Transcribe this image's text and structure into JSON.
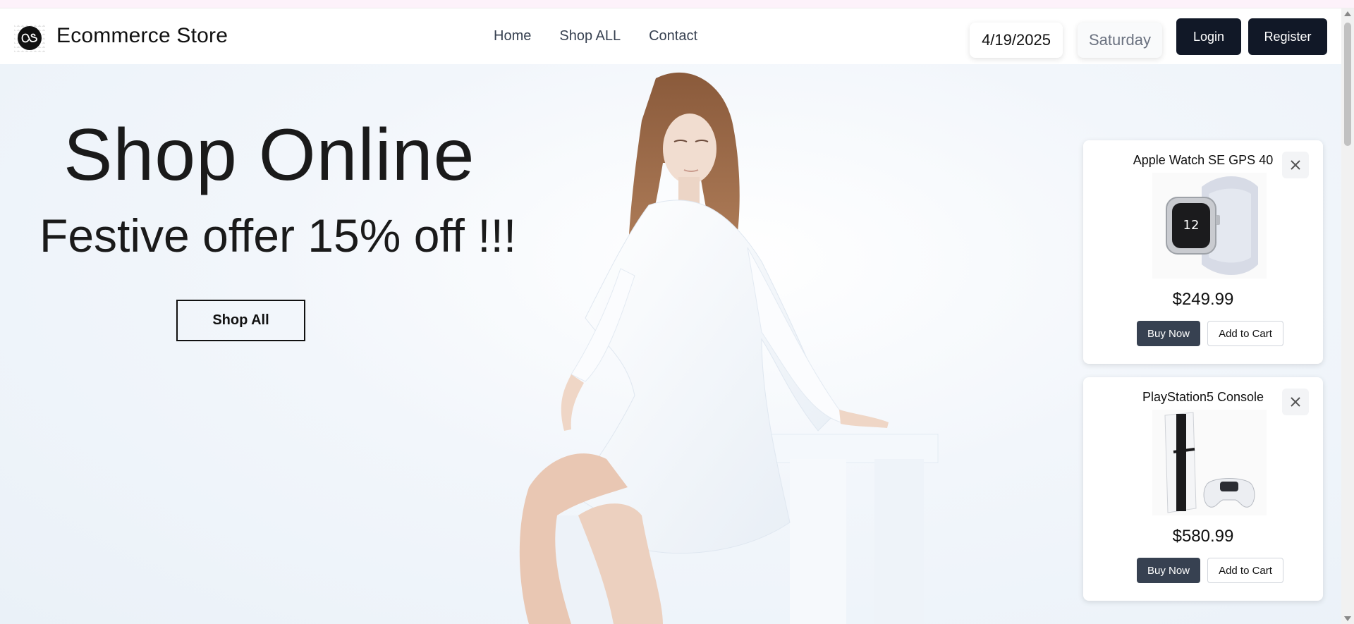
{
  "header": {
    "brand": "Ecommerce Store",
    "logo_icon": "lastfm-logo-icon",
    "nav": [
      "Home",
      "Shop ALL",
      "Contact"
    ],
    "date": "4/19/2025",
    "day": "Saturday",
    "login_label": "Login",
    "register_label": "Register"
  },
  "hero": {
    "title": "Shop Online",
    "subtitle": "Festive offer 15% off !!!",
    "cta_label": "Shop All"
  },
  "products": [
    {
      "title": "Apple Watch SE GPS 40",
      "price": "$249.99",
      "buy_label": "Buy Now",
      "cart_label": "Add to Cart",
      "image_icon": "smartwatch-image"
    },
    {
      "title": "PlayStation5 Console",
      "price": "$580.99",
      "buy_label": "Buy Now",
      "cart_label": "Add to Cart",
      "image_icon": "game-console-image"
    }
  ],
  "colors": {
    "dark_button": "#111827",
    "buy_button": "#374151"
  }
}
